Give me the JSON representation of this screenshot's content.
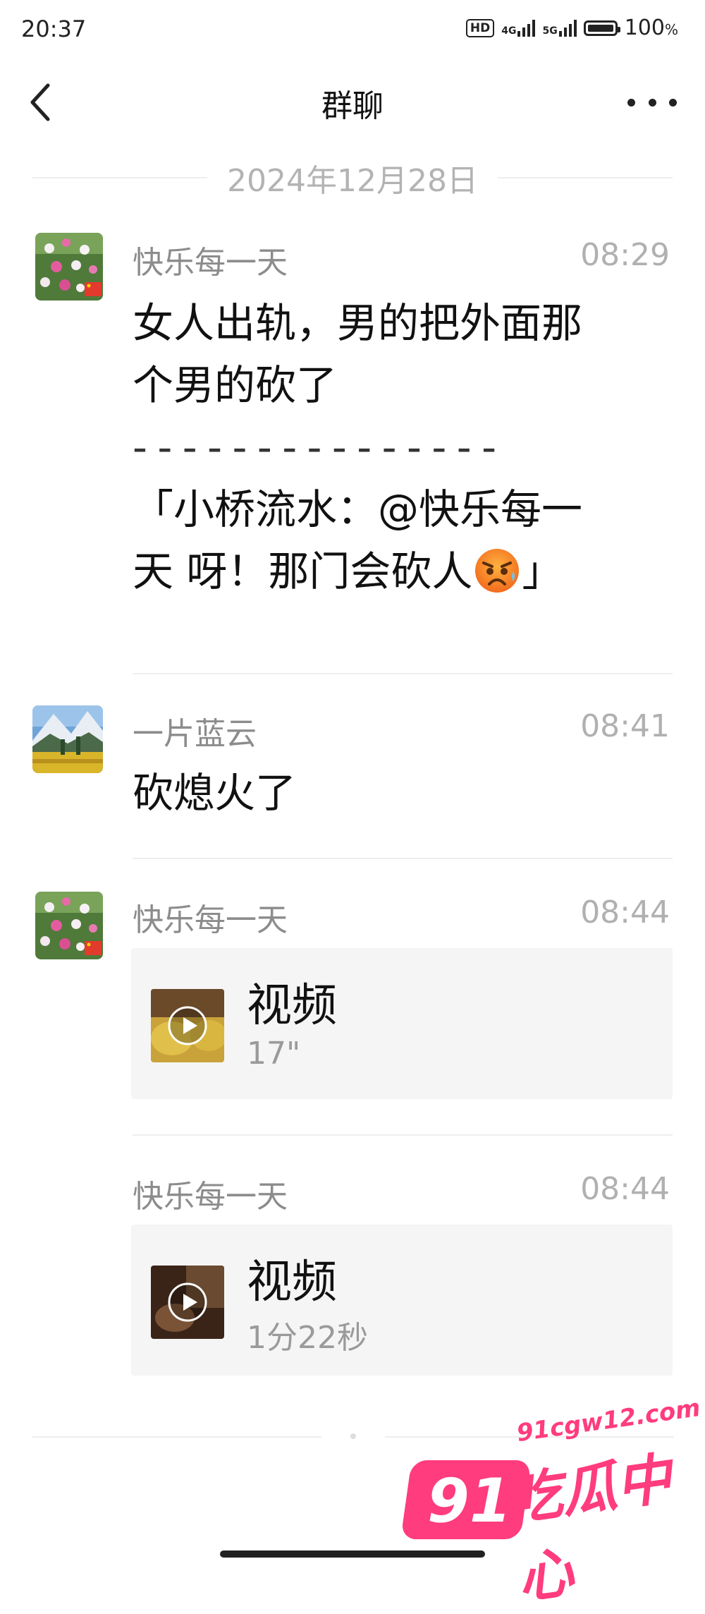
{
  "status_bar": {
    "time": "20:37",
    "hd_badge": "HD",
    "network_1": "4G",
    "network_2": "5G",
    "battery_percent": "100",
    "battery_unit": "%"
  },
  "header": {
    "back_icon": "chevron-left-icon",
    "title": "群聊",
    "more_icon": "more-horizontal-icon"
  },
  "date_divider": "2024年12月28日",
  "messages": [
    {
      "sender": "快乐每一天",
      "time": "08:29",
      "lines": [
        "女人出轨，男的把外面那",
        "个男的砍了",
        "- - - - - - - - - - - - - - -",
        "「小桥流水：@快乐每一",
        "天 呀！那门会砍人"
      ],
      "quote_end": "」",
      "emoji": "anxious-sweat-emoji"
    },
    {
      "sender": "一片蓝云",
      "time": "08:41",
      "text": "砍熄火了"
    },
    {
      "sender": "快乐每一天",
      "time": "08:44",
      "video_label": "视频",
      "duration": "17\""
    },
    {
      "sender": "快乐每一天",
      "time": "08:44",
      "video_label": "视频",
      "duration": "1分22秒"
    }
  ],
  "watermark": {
    "number": "91",
    "url": "91cgw12.com",
    "name": "吃瓜中心"
  },
  "colors": {
    "accent_watermark": "#ff3c7d",
    "secondary_text": "#8c8c8c",
    "card_bg": "#f5f5f5"
  }
}
